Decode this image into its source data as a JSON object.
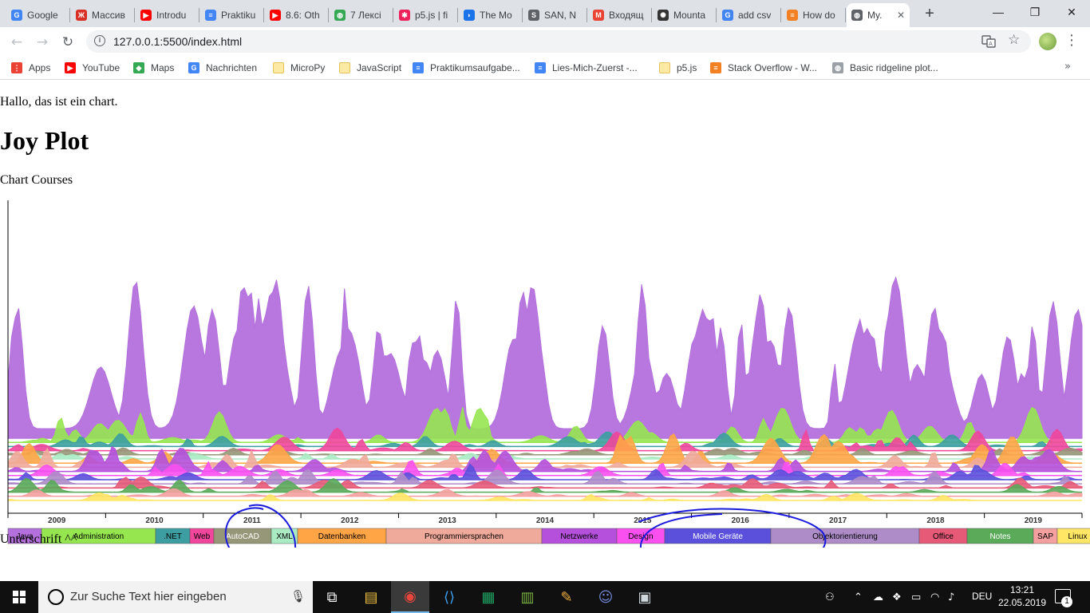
{
  "browser": {
    "tabs": [
      {
        "label": "Google",
        "icon": "google-docs-icon",
        "color": "#4285f4"
      },
      {
        "label": "Массив",
        "icon": "figure-icon",
        "color": "#d93025"
      },
      {
        "label": "Introdu",
        "icon": "youtube-icon",
        "color": "#ff0000"
      },
      {
        "label": "Praktiku",
        "icon": "docs-icon",
        "color": "#4285f4"
      },
      {
        "label": "8.6: Oth",
        "icon": "youtube-icon",
        "color": "#ff0000"
      },
      {
        "label": "7 Лексі",
        "icon": "globe-green-icon",
        "color": "#34a853"
      },
      {
        "label": "p5.js | fi",
        "icon": "p5-star-icon",
        "color": "#ed225d"
      },
      {
        "label": "The Mo",
        "icon": "book-icon",
        "color": "#1a73e8"
      },
      {
        "label": "SAN, N",
        "icon": "sg-icon",
        "color": "#5f6368"
      },
      {
        "label": "Входящ",
        "icon": "gmail-icon",
        "color": "#ea4335"
      },
      {
        "label": "Mounta",
        "icon": "flower-icon",
        "color": "#333333"
      },
      {
        "label": "add csv",
        "icon": "google-icon",
        "color": "#4285f4"
      },
      {
        "label": "How do",
        "icon": "stackoverflow-icon",
        "color": "#f48024"
      },
      {
        "label": "My.",
        "icon": "globe-icon",
        "color": "#5f6368"
      }
    ],
    "active_tab": 13,
    "url": "127.0.0.1:5500/index.html",
    "bookmarks": [
      {
        "label": "Apps",
        "icon": "apps-grid-icon"
      },
      {
        "label": "YouTube",
        "icon": "youtube-icon"
      },
      {
        "label": "Maps",
        "icon": "maps-icon"
      },
      {
        "label": "Nachrichten",
        "icon": "news-icon"
      },
      {
        "label": "MicroPy",
        "icon": "folder-icon"
      },
      {
        "label": "JavaScript",
        "icon": "folder-icon"
      },
      {
        "label": "Praktikumsaufgabe...",
        "icon": "docs-icon"
      },
      {
        "label": "Lies-Mich-Zuerst -...",
        "icon": "docs-icon"
      },
      {
        "label": "p5.js",
        "icon": "folder-icon"
      },
      {
        "label": "Stack Overflow - W...",
        "icon": "stackoverflow-icon"
      },
      {
        "label": "Basic ridgeline plot...",
        "icon": "globe-icon"
      }
    ],
    "more_bookmarks": "»"
  },
  "page": {
    "intro": "Hallo, das ist ein chart.",
    "heading": "Joy Plot",
    "subtitle": "Chart Courses",
    "caption": "Unterschrift ^^"
  },
  "chart_data": {
    "type": "area",
    "xlabel": "",
    "ylabel": "",
    "x_ticks": [
      "2009",
      "2010",
      "2011",
      "2012",
      "2013",
      "2014",
      "2015",
      "2016",
      "2017",
      "2018",
      "2019"
    ],
    "legend": [
      {
        "label": "Java",
        "color": "#b470dc"
      },
      {
        "label": "Administration",
        "color": "#96e650"
      },
      {
        "label": ".NET",
        "color": "#3c9ea0"
      },
      {
        "label": "Web",
        "color": "#f0469b"
      },
      {
        "label": "AutoCAD",
        "color": "#969678"
      },
      {
        "label": "XML",
        "color": "#aaebc3"
      },
      {
        "label": "Datenbanken",
        "color": "#ffa546"
      },
      {
        "label": "Programmiersprachen",
        "color": "#f0aa9b"
      },
      {
        "label": "Netzwerke",
        "color": "#b450dc"
      },
      {
        "label": "Design",
        "color": "#fa50f0"
      },
      {
        "label": "Mobile Geräte",
        "color": "#5a50dc"
      },
      {
        "label": "Objektorientierung",
        "color": "#ae8cc8"
      },
      {
        "label": "Office",
        "color": "#e65a78"
      },
      {
        "label": "Notes",
        "color": "#5aaa5a"
      },
      {
        "label": "SAP",
        "color": "#f5a0a0"
      },
      {
        "label": "Linux",
        "color": "#ffe664"
      }
    ],
    "series_approx_peak": [
      {
        "name": "Java",
        "peak": 190
      },
      {
        "name": "Administration",
        "peak": 45
      },
      {
        "name": ".NET",
        "peak": 20
      },
      {
        "name": "Web",
        "peak": 35
      },
      {
        "name": "AutoCAD",
        "peak": 10
      },
      {
        "name": "XML",
        "peak": 10
      },
      {
        "name": "Datenbanken",
        "peak": 40
      },
      {
        "name": "Programmiersprachen",
        "peak": 25
      },
      {
        "name": "Netzwerke",
        "peak": 35
      },
      {
        "name": "Design",
        "peak": 20
      },
      {
        "name": "Mobile Geräte",
        "peak": 20
      },
      {
        "name": "Objektorientierung",
        "peak": 20
      },
      {
        "name": "Office",
        "peak": 15
      },
      {
        "name": "Notes",
        "peak": 20
      },
      {
        "name": "SAP",
        "peak": 10
      },
      {
        "name": "Linux",
        "peak": 10
      }
    ],
    "annotations": [
      "blue hand-drawn circle around AutoCAD / XML",
      "blue hand-drawn ellipse around Mobile Geräte"
    ]
  },
  "taskbar": {
    "search_placeholder": "Zur Suche Text hier eingeben",
    "apps": [
      "task-view-icon",
      "explorer-icon",
      "chrome-icon",
      "vscode-icon",
      "sheets-icon",
      "chart-app-icon",
      "paint-icon",
      "discord-icon",
      "screenshot-icon"
    ],
    "lang": "DEU",
    "time": "13:21",
    "date": "22.05.2019",
    "notification_count": "1"
  }
}
